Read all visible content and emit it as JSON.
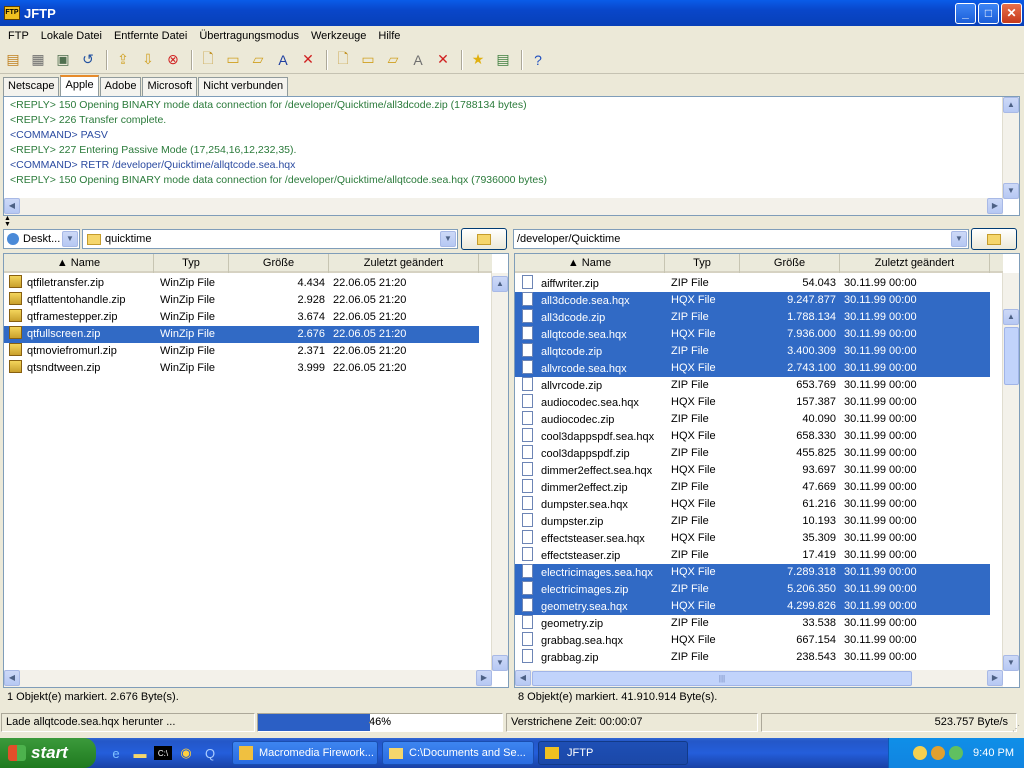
{
  "window": {
    "title": "JFTP"
  },
  "menu": [
    "FTP",
    "Lokale Datei",
    "Entfernte Datei",
    "Übertragungsmodus",
    "Werkzeuge",
    "Hilfe"
  ],
  "tabs": [
    "Netscape",
    "Apple",
    "Adobe",
    "Microsoft",
    "Nicht verbunden"
  ],
  "active_tab": "Apple",
  "log": [
    {
      "prefix": "<REPLY>",
      "text": " 150 Opening BINARY mode data connection for /developer/Quicktime/all3dcode.zip (1788134 bytes)"
    },
    {
      "prefix": "<REPLY>",
      "text": " 226 Transfer complete."
    },
    {
      "prefix": "<COMMAND>",
      "text": " PASV"
    },
    {
      "prefix": "<REPLY>",
      "text": " 227 Entering Passive Mode (17,254,16,12,232,35)."
    },
    {
      "prefix": "<COMMAND>",
      "text": " RETR /developer/Quicktime/allqtcode.sea.hqx"
    },
    {
      "prefix": "<REPLY>",
      "text": " 150 Opening BINARY mode data connection for /developer/Quicktime/allqtcode.sea.hqx (7936000 bytes)"
    }
  ],
  "local": {
    "drive": "Deskt...",
    "folder": "quicktime",
    "columns": [
      "Name",
      "Typ",
      "Größe",
      "Zuletzt geändert"
    ],
    "files": [
      {
        "name": "qtfiletransfer.zip",
        "type": "WinZip File",
        "size": "4.434",
        "date": "22.06.05 21:20",
        "selected": false
      },
      {
        "name": "qtflattentohandle.zip",
        "type": "WinZip File",
        "size": "2.928",
        "date": "22.06.05 21:20",
        "selected": false
      },
      {
        "name": "qtframestepper.zip",
        "type": "WinZip File",
        "size": "3.674",
        "date": "22.06.05 21:20",
        "selected": false
      },
      {
        "name": "qtfullscreen.zip",
        "type": "WinZip File",
        "size": "2.676",
        "date": "22.06.05 21:20",
        "selected": true
      },
      {
        "name": "qtmoviefromurl.zip",
        "type": "WinZip File",
        "size": "2.371",
        "date": "22.06.05 21:20",
        "selected": false
      },
      {
        "name": "qtsndtween.zip",
        "type": "WinZip File",
        "size": "3.999",
        "date": "22.06.05 21:20",
        "selected": false
      }
    ],
    "status": "1 Objekt(e) markiert. 2.676 Byte(s)."
  },
  "remote": {
    "path": "/developer/Quicktime",
    "columns": [
      "Name",
      "Typ",
      "Größe",
      "Zuletzt geändert"
    ],
    "files": [
      {
        "name": "aiffwriter.zip",
        "type": "ZIP File",
        "size": "54.043",
        "date": "30.11.99 00:00",
        "selected": false
      },
      {
        "name": "all3dcode.sea.hqx",
        "type": "HQX File",
        "size": "9.247.877",
        "date": "30.11.99 00:00",
        "selected": true
      },
      {
        "name": "all3dcode.zip",
        "type": "ZIP File",
        "size": "1.788.134",
        "date": "30.11.99 00:00",
        "selected": true
      },
      {
        "name": "allqtcode.sea.hqx",
        "type": "HQX File",
        "size": "7.936.000",
        "date": "30.11.99 00:00",
        "selected": true
      },
      {
        "name": "allqtcode.zip",
        "type": "ZIP File",
        "size": "3.400.309",
        "date": "30.11.99 00:00",
        "selected": true
      },
      {
        "name": "allvrcode.sea.hqx",
        "type": "HQX File",
        "size": "2.743.100",
        "date": "30.11.99 00:00",
        "selected": true
      },
      {
        "name": "allvrcode.zip",
        "type": "ZIP File",
        "size": "653.769",
        "date": "30.11.99 00:00",
        "selected": false
      },
      {
        "name": "audiocodec.sea.hqx",
        "type": "HQX File",
        "size": "157.387",
        "date": "30.11.99 00:00",
        "selected": false
      },
      {
        "name": "audiocodec.zip",
        "type": "ZIP File",
        "size": "40.090",
        "date": "30.11.99 00:00",
        "selected": false
      },
      {
        "name": "cool3dappspdf.sea.hqx",
        "type": "HQX File",
        "size": "658.330",
        "date": "30.11.99 00:00",
        "selected": false
      },
      {
        "name": "cool3dappspdf.zip",
        "type": "ZIP File",
        "size": "455.825",
        "date": "30.11.99 00:00",
        "selected": false
      },
      {
        "name": "dimmer2effect.sea.hqx",
        "type": "HQX File",
        "size": "93.697",
        "date": "30.11.99 00:00",
        "selected": false
      },
      {
        "name": "dimmer2effect.zip",
        "type": "ZIP File",
        "size": "47.669",
        "date": "30.11.99 00:00",
        "selected": false
      },
      {
        "name": "dumpster.sea.hqx",
        "type": "HQX File",
        "size": "61.216",
        "date": "30.11.99 00:00",
        "selected": false
      },
      {
        "name": "dumpster.zip",
        "type": "ZIP File",
        "size": "10.193",
        "date": "30.11.99 00:00",
        "selected": false
      },
      {
        "name": "effectsteaser.sea.hqx",
        "type": "HQX File",
        "size": "35.309",
        "date": "30.11.99 00:00",
        "selected": false
      },
      {
        "name": "effectsteaser.zip",
        "type": "ZIP File",
        "size": "17.419",
        "date": "30.11.99 00:00",
        "selected": false
      },
      {
        "name": "electricimages.sea.hqx",
        "type": "HQX File",
        "size": "7.289.318",
        "date": "30.11.99 00:00",
        "selected": true
      },
      {
        "name": "electricimages.zip",
        "type": "ZIP File",
        "size": "5.206.350",
        "date": "30.11.99 00:00",
        "selected": true
      },
      {
        "name": "geometry.sea.hqx",
        "type": "HQX File",
        "size": "4.299.826",
        "date": "30.11.99 00:00",
        "selected": true
      },
      {
        "name": "geometry.zip",
        "type": "ZIP File",
        "size": "33.538",
        "date": "30.11.99 00:00",
        "selected": false
      },
      {
        "name": "grabbag.sea.hqx",
        "type": "HQX File",
        "size": "667.154",
        "date": "30.11.99 00:00",
        "selected": false
      },
      {
        "name": "grabbag.zip",
        "type": "ZIP File",
        "size": "238.543",
        "date": "30.11.99 00:00",
        "selected": false
      }
    ],
    "status": "8 Objekt(e) markiert. 41.910.914 Byte(s)."
  },
  "statusbar": {
    "download": "Lade allqtcode.sea.hqx herunter ...",
    "progress_percent": 46,
    "progress_label": "46%",
    "elapsed": "Verstrichene Zeit: 00:00:07",
    "rate": "523.757 Byte/s"
  },
  "taskbar": {
    "start": "start",
    "items": [
      "Macromedia Firework...",
      "C:\\Documents and Se...",
      "JFTP"
    ],
    "active_item": "JFTP",
    "clock": "9:40 PM"
  },
  "colors": {
    "selection": "#316ac5",
    "titlebar": "#0a5ce8",
    "taskbar": "#245edb"
  }
}
